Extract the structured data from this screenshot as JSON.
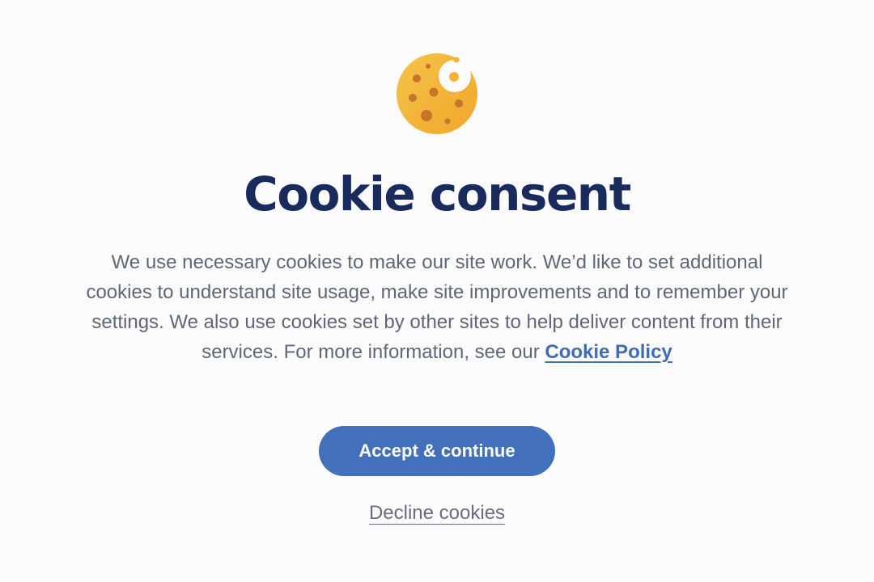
{
  "dialog": {
    "icon": "cookie-icon",
    "title": "Cookie consent",
    "body_text": "We use necessary cookies to make our site work. We’d like to set additional cookies to understand site usage, make site improvements and to remember your settings. We also use cookies set by other sites to help deliver content from their services.  For more information, see our",
    "policy_link_label": "Cookie Policy",
    "accept_button_label": "Accept & continue",
    "decline_link_label": "Decline cookies"
  },
  "colors": {
    "background": "#fbfbfc",
    "title": "#182b5c",
    "body_text": "#5e6678",
    "link": "#3f6db3",
    "accept_button": "#4370bb",
    "decline_link": "#6b6a85",
    "cookie": "#f2b437",
    "cookie_chip": "#c8742a"
  }
}
